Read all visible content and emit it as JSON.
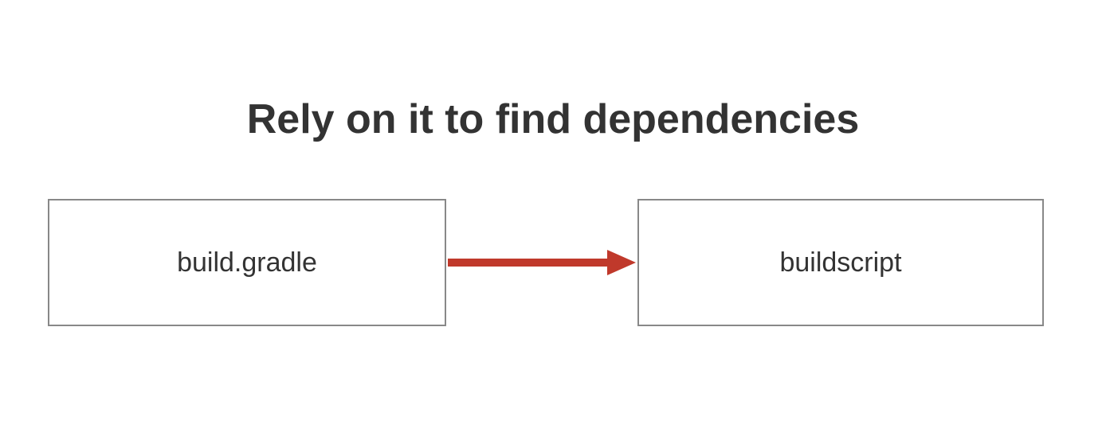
{
  "title": "Rely on it to find dependencies",
  "nodes": {
    "left": "build.gradle",
    "right": "buildscript"
  },
  "arrow_color": "#c0392b"
}
